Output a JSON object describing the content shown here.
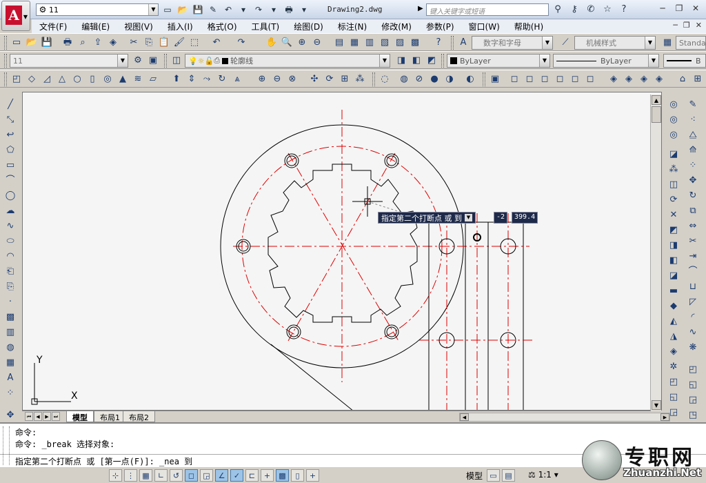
{
  "title": {
    "workspace": "11",
    "document": "Drawing2.dwg",
    "search_placeholder": "键入关键字或短语"
  },
  "menu": [
    "文件(F)",
    "编辑(E)",
    "视图(V)",
    "插入(I)",
    "格式(O)",
    "工具(T)",
    "绘图(D)",
    "标注(N)",
    "修改(M)",
    "参数(P)",
    "窗口(W)",
    "帮助(H)"
  ],
  "toolbar": {
    "text_style": "数字和字母",
    "dim_style": "机械样式",
    "table_style": "Standa",
    "workspace_combo": "11",
    "layer": "轮廓线",
    "color": "ByLayer",
    "linetype": "ByLayer",
    "lineweight": "B"
  },
  "tooltip": {
    "prompt": "指定第二个打断点 或 到",
    "input_value": "-2",
    "input_value2": "399.4"
  },
  "tabs": [
    "模型",
    "布局1",
    "布局2"
  ],
  "command": {
    "line1": "命令:",
    "line2": "命令: _break 选择对象:",
    "line3": "指定第二个打断点 或 [第一点(F)]: _nea 到"
  },
  "axis": {
    "x": "X",
    "y": "Y"
  },
  "status": {
    "model_label": "模型",
    "scale": "1:1"
  },
  "watermark": {
    "name": "专职网",
    "url": "Zhuanzhi.Net"
  }
}
